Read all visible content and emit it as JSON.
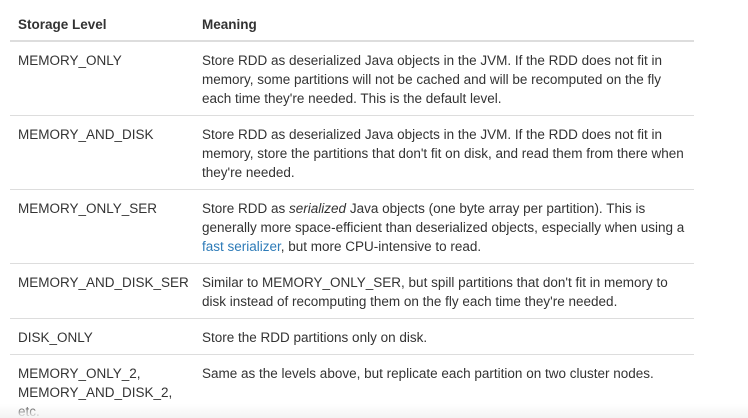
{
  "table": {
    "headers": {
      "level": "Storage Level",
      "meaning": "Meaning"
    },
    "rows": [
      {
        "level": "MEMORY_ONLY",
        "meaning": "Store RDD as deserialized Java objects in the JVM. If the RDD does not fit in memory, some partitions will not be cached and will be recomputed on the fly each time they're needed. This is the default level."
      },
      {
        "level": "MEMORY_AND_DISK",
        "meaning": "Store RDD as deserialized Java objects in the JVM. If the RDD does not fit in memory, store the partitions that don't fit on disk, and read them from there when they're needed."
      },
      {
        "level": "MEMORY_ONLY_SER",
        "meaning_pre": "Store RDD as ",
        "meaning_em": "serialized",
        "meaning_mid": " Java objects (one byte array per partition). This is generally more space-efficient than deserialized objects, especially when using a ",
        "meaning_link": "fast serializer",
        "meaning_post": ", but more CPU-intensive to read."
      },
      {
        "level": "MEMORY_AND_DISK_SER",
        "meaning": "Similar to MEMORY_ONLY_SER, but spill partitions that don't fit in memory to disk instead of recomputing them on the fly each time they're needed."
      },
      {
        "level": "DISK_ONLY",
        "meaning": "Store the RDD partitions only on disk."
      },
      {
        "level_lines": [
          "MEMORY_ONLY_2,",
          "MEMORY_AND_DISK_2,",
          "etc."
        ],
        "meaning": "Same as the levels above, but replicate each partition on two cluster nodes."
      }
    ]
  },
  "colors": {
    "text": "#333333",
    "link": "#2d7bb8",
    "border": "#dddddd"
  }
}
